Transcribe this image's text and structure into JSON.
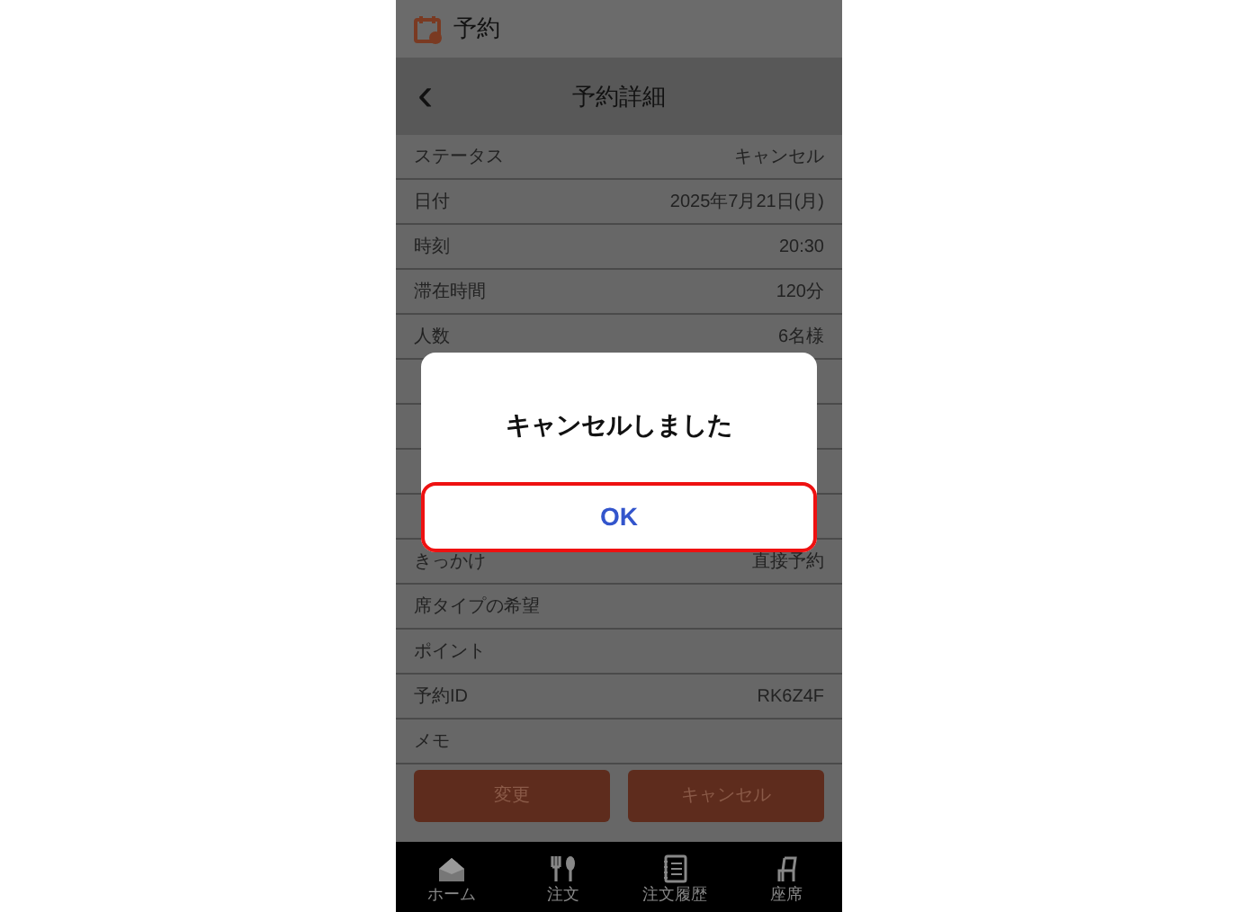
{
  "app_bar": {
    "title": "予約"
  },
  "header": {
    "title": "予約詳細",
    "back": "‹"
  },
  "rows_above_dialog": [
    {
      "label": "ステータス",
      "value": "キャンセル"
    },
    {
      "label": "日付",
      "value": "2025年7月21日(月)"
    },
    {
      "label": "時刻",
      "value": "20:30"
    },
    {
      "label": "滞在時間",
      "value": "120分"
    },
    {
      "label": "人数",
      "value": "6名様"
    }
  ],
  "rows_below_dialog": [
    {
      "label": "きっかけ",
      "value": "直接予約"
    },
    {
      "label": "席タイプの希望"
    },
    {
      "label": "ポイント"
    },
    {
      "label": "予約ID",
      "value": "RK6Z4F"
    },
    {
      "label": "メモ"
    }
  ],
  "buttons": [
    "変更",
    "キャンセル"
  ],
  "tab_bar": [
    {
      "label": "ホーム"
    },
    {
      "label": "注文"
    },
    {
      "label": "注文履歴"
    },
    {
      "label": "座席"
    }
  ],
  "dialog": {
    "message": "キャンセルしました",
    "button": "OK",
    "button_focused": true
  }
}
